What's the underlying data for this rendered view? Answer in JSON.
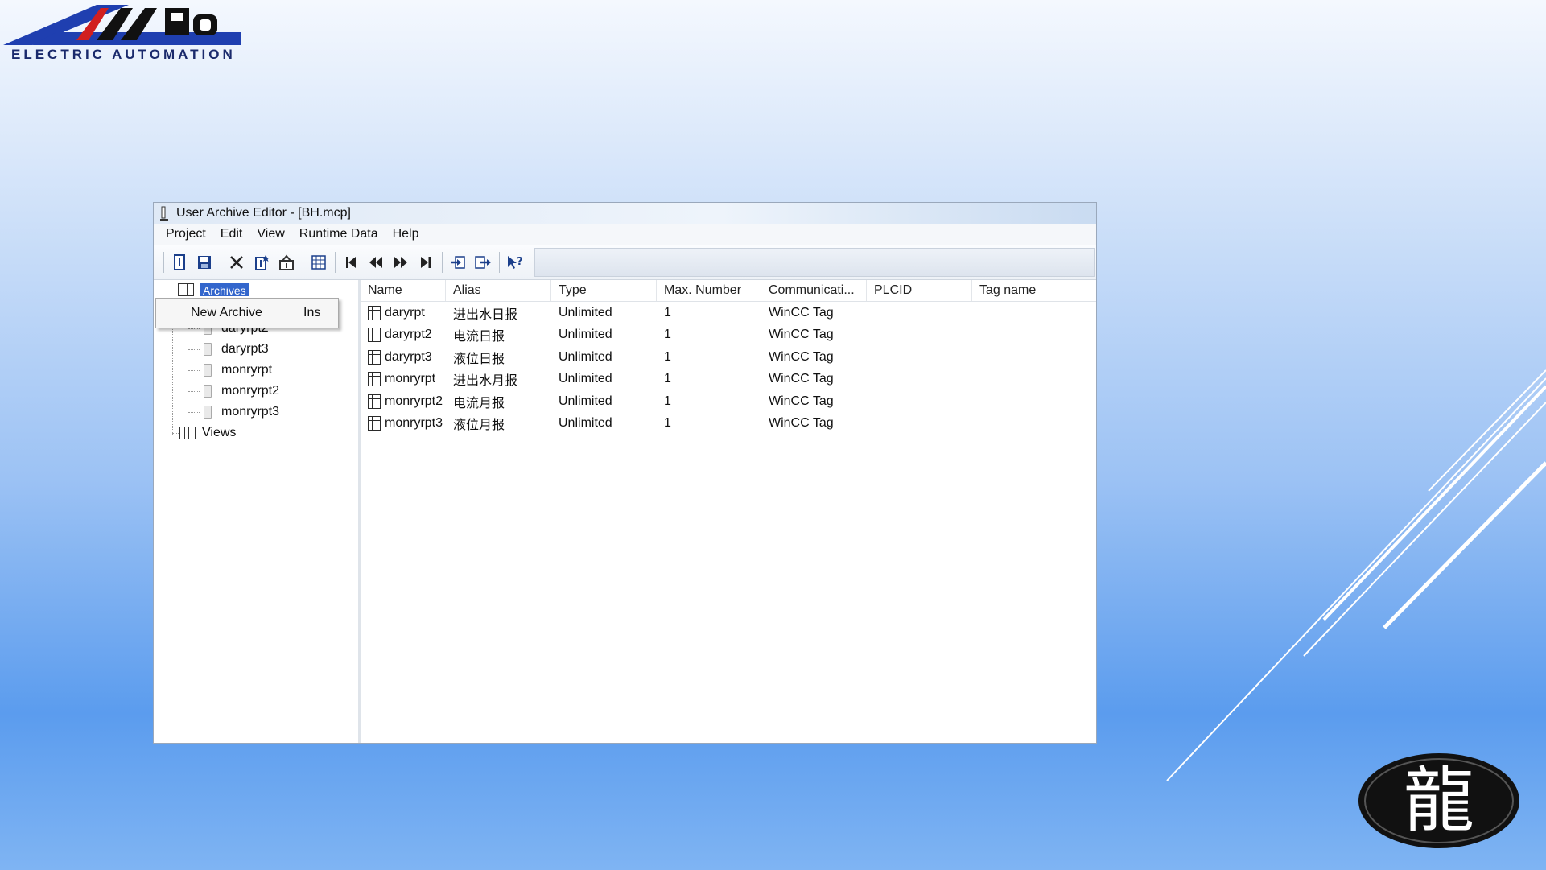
{
  "logo": {
    "brand": "AMPO",
    "tagline": "ELECTRIC AUTOMATION"
  },
  "window": {
    "title": "User Archive Editor - [BH.mcp]",
    "menu": [
      "Project",
      "Edit",
      "View",
      "Runtime Data",
      "Help"
    ],
    "toolbar_icons": [
      "properties-icon",
      "save-icon",
      "delete-icon",
      "new-field-icon",
      "tag-icon",
      "grid-icon",
      "first-record-icon",
      "previous-record-icon",
      "next-record-icon",
      "last-record-icon",
      "import-icon",
      "export-icon",
      "help-icon"
    ]
  },
  "tree": {
    "root_label": "Archives",
    "items": [
      "daryrpt2",
      "daryrpt3",
      "monryrpt",
      "monryrpt2",
      "monryrpt3"
    ],
    "views_label": "Views"
  },
  "context_menu": {
    "label": "New Archive",
    "shortcut": "Ins"
  },
  "table": {
    "columns": [
      "Name",
      "Alias",
      "Type",
      "Max. Number",
      "Communicati...",
      "PLCID",
      "Tag name"
    ],
    "rows": [
      [
        "daryrpt",
        "进出水日报",
        "Unlimited",
        "1",
        "WinCC Tag",
        "",
        ""
      ],
      [
        "daryrpt2",
        "电流日报",
        "Unlimited",
        "1",
        "WinCC Tag",
        "",
        ""
      ],
      [
        "daryrpt3",
        "液位日报",
        "Unlimited",
        "1",
        "WinCC Tag",
        "",
        ""
      ],
      [
        "monryrpt",
        "进出水月报",
        "Unlimited",
        "1",
        "WinCC Tag",
        "",
        ""
      ],
      [
        "monryrpt2",
        "电流月报",
        "Unlimited",
        "1",
        "WinCC Tag",
        "",
        ""
      ],
      [
        "monryrpt3",
        "液位月报",
        "Unlimited",
        "1",
        "WinCC Tag",
        "",
        ""
      ]
    ]
  },
  "seal": {
    "glyph": "龍"
  }
}
